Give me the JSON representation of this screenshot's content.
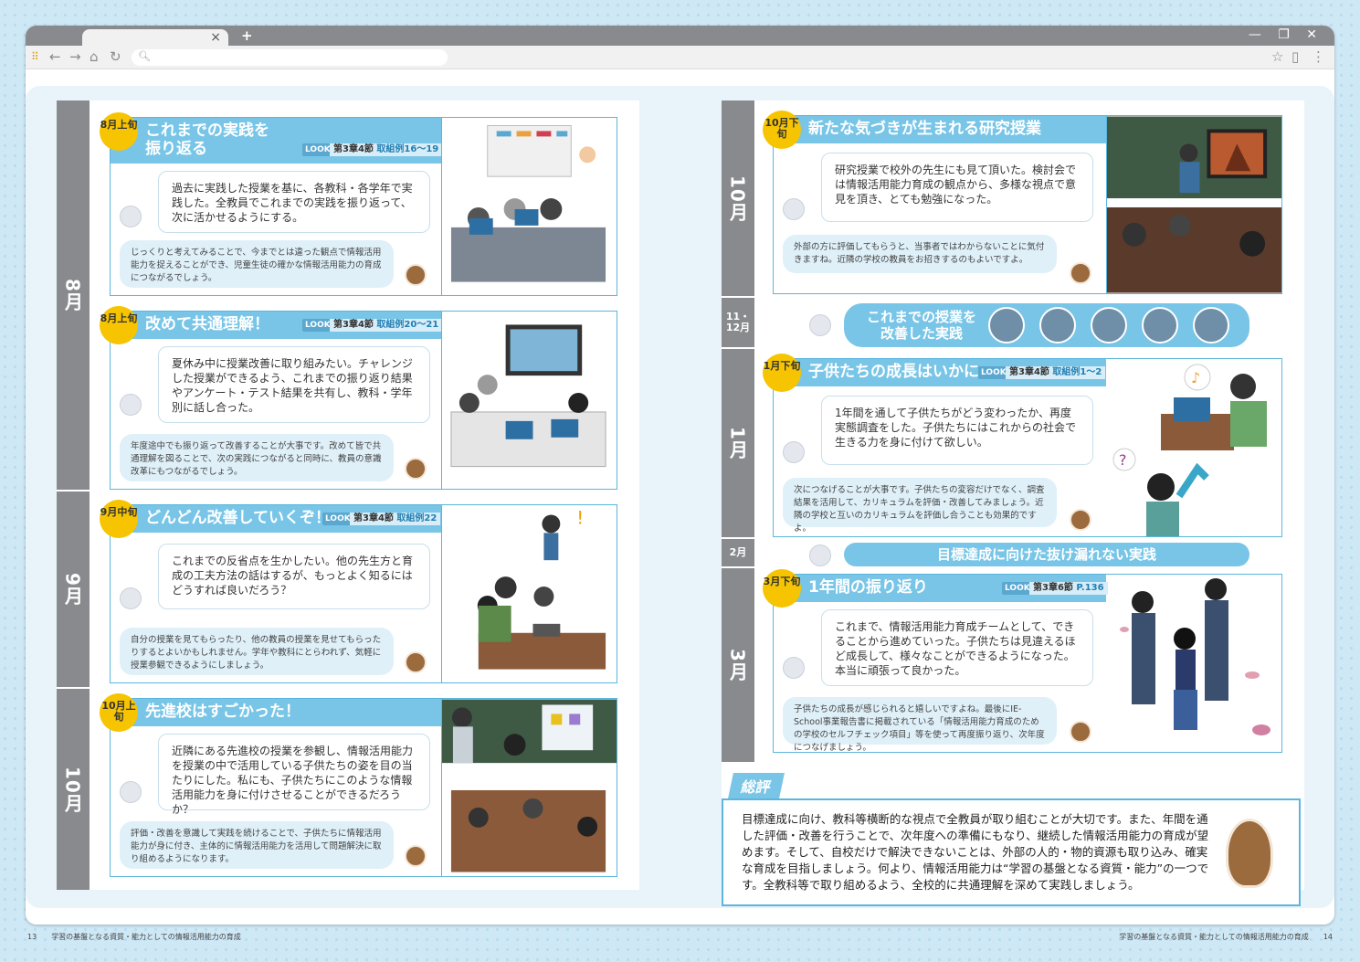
{
  "browser": {
    "tab_close": "×",
    "new_tab": "+",
    "win_controls": "— ❐ ✕",
    "icons": [
      "apps-icon",
      "back-icon",
      "forward-icon",
      "home-icon",
      "reload-icon",
      "search-icon",
      "star-icon",
      "page-icon",
      "menu-icon"
    ]
  },
  "left": {
    "months": [
      {
        "label": "8月"
      },
      {
        "label": "9月"
      },
      {
        "label": "10月"
      }
    ],
    "cards": [
      {
        "badge": "8月上旬",
        "title": "これまでの実践を振り返る",
        "look": "LOOK",
        "ref_chapter": "第3章4節",
        "ref_case": "取組例16〜19",
        "bubble": "過去に実践した授業を基に、各教科・各学年で実践した。全教員でこれまでの実践を振り返って、次に活かせるようにする。",
        "note": "じっくりと考えてみることで、今までとは違った観点で情報活用能力を捉えることができ、児童生徒の確かな情報活用能力の育成につながるでしょう。"
      },
      {
        "badge": "8月上旬",
        "title": "改めて共通理解！",
        "look": "LOOK",
        "ref_chapter": "第3章4節",
        "ref_case": "取組例20〜21",
        "bubble": "夏休み中に授業改善に取り組みたい。チャレンジした授業ができるよう、これまでの振り返り結果やアンケート・テスト結果を共有し、教科・学年別に話し合った。",
        "note": "年度途中でも振り返って改善することが大事です。改めて皆で共通理解を図ることで、次の実践につながると同時に、教員の意識改革にもつながるでしょう。"
      },
      {
        "badge": "9月中旬",
        "title": "どんどん改善していくぞ！",
        "look": "LOOK",
        "ref_chapter": "第3章4節",
        "ref_case": "取組例22",
        "bubble": "これまでの反省点を生かしたい。他の先生方と育成の工夫方法の話はするが、もっとよく知るにはどうすれば良いだろう？",
        "note": "自分の授業を見てもらったり、他の教員の授業を見せてもらったりするとよいかもしれません。学年や教科にとらわれず、気軽に授業参観できるようにしましょう。"
      },
      {
        "badge": "10月上旬",
        "title": "先進校はすごかった！",
        "bubble": "近隣にある先進校の授業を参観し、情報活用能力を授業の中で活用している子供たちの姿を目の当たりにした。私にも、子供たちにこのような情報活用能力を身に付けさせることができるだろうか？",
        "note": "評価・改善を意識して実践を続けることで、子供たちに情報活用能力が身に付き、主体的に情報活用能力を活用して問題解決に取り組めるようになります。"
      }
    ]
  },
  "right": {
    "months": [
      {
        "label": "10月"
      },
      {
        "label": "11・12月"
      },
      {
        "label": "1月"
      },
      {
        "label": "2月"
      },
      {
        "label": "3月"
      }
    ],
    "cards": [
      {
        "badge": "10月下旬",
        "title": "新たな気づきが生まれる研究授業",
        "bubble": "研究授業で校外の先生にも見て頂いた。検討会では情報活用能力育成の観点から、多様な視点で意見を頂き、とても勉強になった。",
        "note": "外部の方に評価してもらうと、当事者ではわからないことに気付きますね。近隣の学校の教員をお招きするのもよいですよ。"
      },
      {
        "badge": "1月下旬",
        "title": "子供たちの成長はいかに",
        "look": "LOOK",
        "ref_chapter": "第3章4節",
        "ref_case": "取組例1〜2",
        "bubble": "1年間を通して子供たちがどう変わったか、再度実態調査をした。子供たちにはこれからの社会で生きる力を身に付けて欲しい。",
        "note": "次につなげることが大事です。子供たちの変容だけでなく、調査結果を活用して、カリキュラムを評価・改善してみましょう。近隣の学校と互いのカリキュラムを評価し合うことも効果的ですよ。"
      },
      {
        "badge": "3月下旬",
        "title": "1年間の振り返り",
        "look": "LOOK",
        "ref_chapter": "第3章6節",
        "ref_case": "P.136",
        "bubble": "これまで、情報活用能力育成チームとして、できることから進めていった。子供たちは見違えるほど成長して、様々なことができるようになった。本当に頑張って良かった。",
        "note": "子供たちの成長が感じられると嬉しいですよね。最後にIE-School事業報告書に掲載されている「情報活用能力育成のための学校のセルフチェック項目」等を使って再度振り返り、次年度につなげましょう。"
      }
    ],
    "banner1": "これまでの授業を改善した実践",
    "banner2": "目標達成に向けた抜け漏れない実践",
    "review_tag": "総評",
    "review": "目標達成に向け、教科等横断的な視点で全教員が取り組むことが大切です。また、年間を通した評価・改善を行うことで、次年度への準備にもなり、継続した情報活用能力の育成が望めます。そして、自校だけで解決できないことは、外部の人的・物的資源も取り込み、確実な育成を目指しましょう。何より、情報活用能力は“学習の基盤となる資質・能力”の一つです。全教科等で取り組めるよう、全校的に共通理解を深めて実践しましょう。"
  },
  "footer": {
    "left_page": "13",
    "left_title": "学習の基盤となる資質・能力としての情報活用能力の育成",
    "right_title": "学習の基盤となる資質・能力としての情報活用能力の育成",
    "right_page": "14"
  },
  "colors": {
    "accent": "#78c5e7",
    "border": "#5bb5dd",
    "month_bar": "#888a8d",
    "badge": "#f6c400"
  }
}
